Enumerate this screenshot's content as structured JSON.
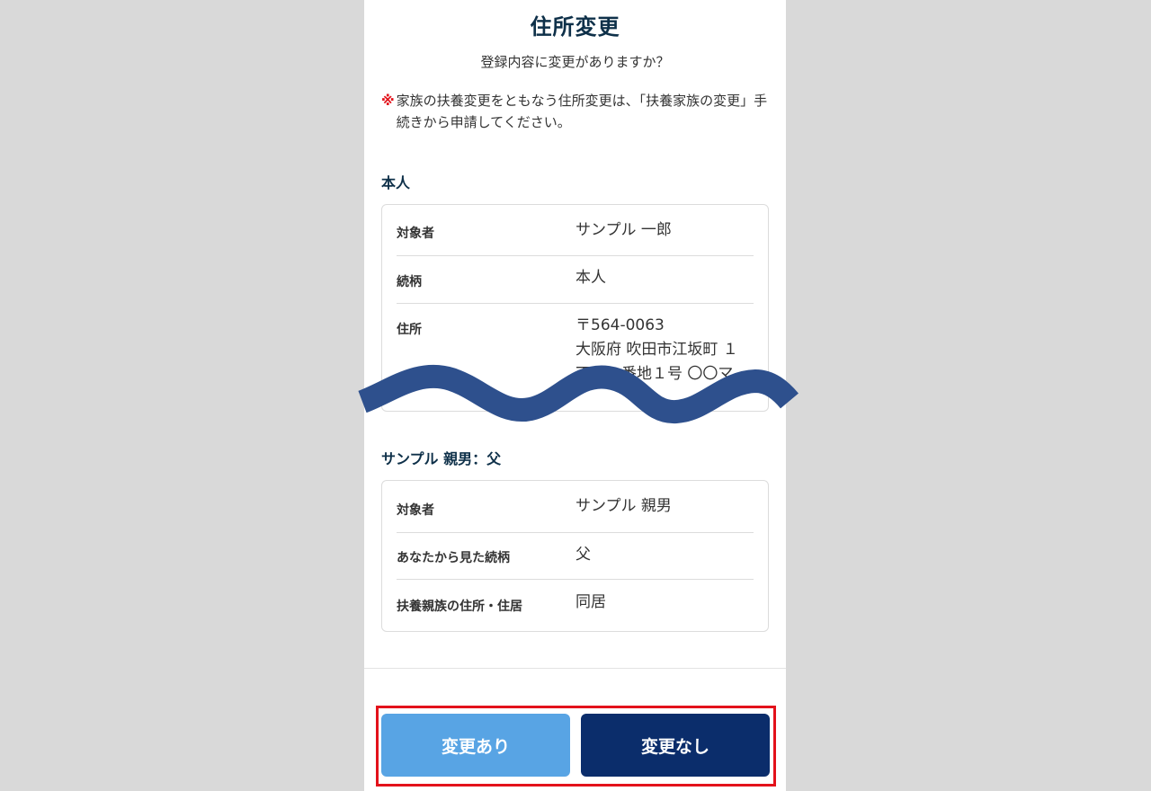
{
  "page": {
    "title": "住所変更",
    "subtitle": "登録内容に変更がありますか？",
    "notice_mark": "※",
    "notice_text": "家族の扶養変更をともなう住所変更は、「扶養家族の変更」手続きから申請してください。"
  },
  "self_section": {
    "title": "本人",
    "rows": [
      {
        "label": "対象者",
        "value": "サンプル 一郎"
      },
      {
        "label": "続柄",
        "value": "本人"
      },
      {
        "label": "住所",
        "value_lines": [
          "〒564-0063",
          "大阪府 吹田市江坂町 １",
          "丁目１番地１号 〇〇マ"
        ]
      }
    ]
  },
  "family_section": {
    "title": "サンプル 親男：父",
    "rows": [
      {
        "label": "対象者",
        "value": "サンプル 親男"
      },
      {
        "label": "あなたから見た続柄",
        "value": "父"
      },
      {
        "label": "扶養親族の住所・住居",
        "value": "同居"
      }
    ]
  },
  "buttons": {
    "yes_label": "変更あり",
    "no_label": "変更なし"
  },
  "colors": {
    "title": "#0e3049",
    "notice_mark": "#e3121b",
    "wave": "#2e508d",
    "yes_button": "#58a4e4",
    "no_button": "#0b2d6b",
    "highlight_border": "#e3121b"
  }
}
